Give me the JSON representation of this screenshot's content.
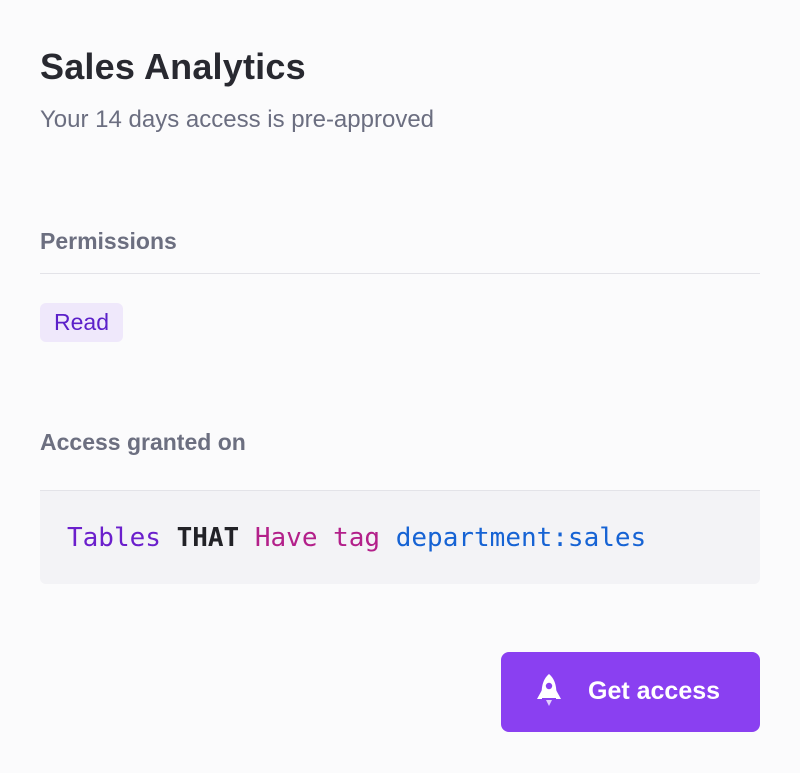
{
  "header": {
    "title": "Sales Analytics",
    "subtitle": "Your 14 days access is pre-approved"
  },
  "permissions": {
    "heading": "Permissions",
    "items": [
      "Read"
    ]
  },
  "access": {
    "heading": "Access granted on",
    "rule_tokens": {
      "subject": "Tables",
      "keyword": "THAT",
      "verb": "Have tag",
      "value": "department:sales"
    }
  },
  "action": {
    "label": "Get access",
    "icon": "rocket-icon"
  },
  "colors": {
    "accent": "#8a40f1",
    "badge_bg": "#efe8fb",
    "badge_text": "#5b20c9",
    "token_subject": "#6b1fcc",
    "token_verb": "#b3208a",
    "token_value": "#1663d4"
  }
}
